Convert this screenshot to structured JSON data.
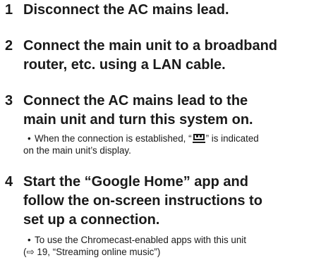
{
  "steps": [
    {
      "number": "1",
      "lines": [
        "Disconnect the AC mains lead."
      ]
    },
    {
      "number": "2",
      "lines": [
        "Connect the main unit to a broadband",
        "router, etc. using a LAN cable."
      ]
    },
    {
      "number": "3",
      "lines": [
        "Connect the AC mains lead to the",
        "main unit and turn this system on."
      ],
      "note": {
        "bullet": "•",
        "line1_before_icon": "When the connection is established, “",
        "icon": "lan-icon",
        "line1_after_icon": "” is indicated",
        "line2": "on the main unit’s display."
      }
    },
    {
      "number": "4",
      "lines": [
        "Start the “Google Home” app and",
        "follow the on-screen instructions to",
        "set up a connection."
      ],
      "note": {
        "bullet": "•",
        "line1": "To use the Chromecast-enabled apps with this unit",
        "line2": "(⇨ 19, “Streaming online music”)"
      }
    }
  ]
}
